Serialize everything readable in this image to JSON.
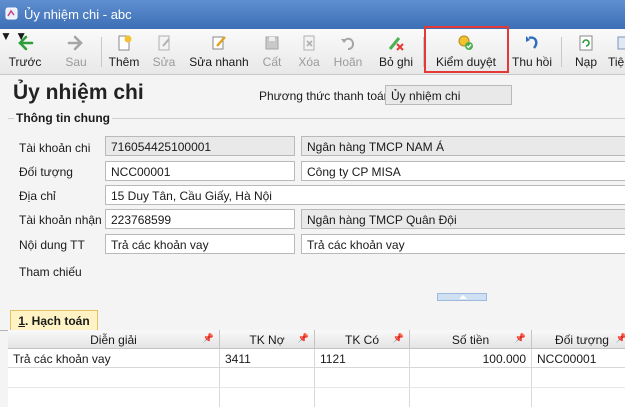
{
  "window": {
    "title": "Ủy nhiệm chi - abc"
  },
  "toolbar": {
    "back": "Trước",
    "next": "Sau",
    "add": "Thêm",
    "edit": "Sửa",
    "quick_edit": "Sửa nhanh",
    "save": "Cất",
    "delete": "Xóa",
    "undo": "Hoãn",
    "record": "Bỏ ghi",
    "approve": "Kiểm duyệt",
    "revoke": "Thu hồi",
    "load": "Nạp",
    "more": "Tiệ"
  },
  "form": {
    "title": "Ủy nhiệm chi",
    "payment_method_label": "Phương thức thanh toán",
    "payment_method_value": "Ủy nhiệm chi",
    "group_title": "Thông tin chung",
    "rows": {
      "account_label": "Tài khoản chi",
      "account_value": "716054425100001",
      "account_bank": "Ngân hàng TMCP NAM Á",
      "object_label": "Đối tượng",
      "object_code": "NCC00001",
      "object_name": "Công ty CP MISA",
      "address_label": "Địa chỉ",
      "address_value": "15 Duy Tân, Cầu Giấy, Hà Nội",
      "receive_account_label": "Tài khoản nhận",
      "receive_account_value": "223768599",
      "receive_bank": "Ngân hàng TMCP Quân Đội",
      "content_label": "Nội dung TT",
      "content_value_1": "Trả các khoản vay",
      "content_value_2": "Trả các khoản vay",
      "reference_label": "Tham chiếu"
    }
  },
  "tabs": {
    "accounting_num": "1",
    "accounting_rest": ". Hạch toán"
  },
  "grid": {
    "headers": [
      "Diễn giải",
      "TK Nợ",
      "TK Có",
      "Số tiền",
      "Đối tượng"
    ],
    "rows": [
      {
        "desc": "Trả các khoản vay",
        "debit": "3411",
        "credit": "1121",
        "amount": "100.000",
        "object": "NCC00001"
      }
    ]
  },
  "colors": {
    "highlight": "#e53935",
    "titlebar": "#4a7bc0",
    "tab": "#fff3c5"
  }
}
